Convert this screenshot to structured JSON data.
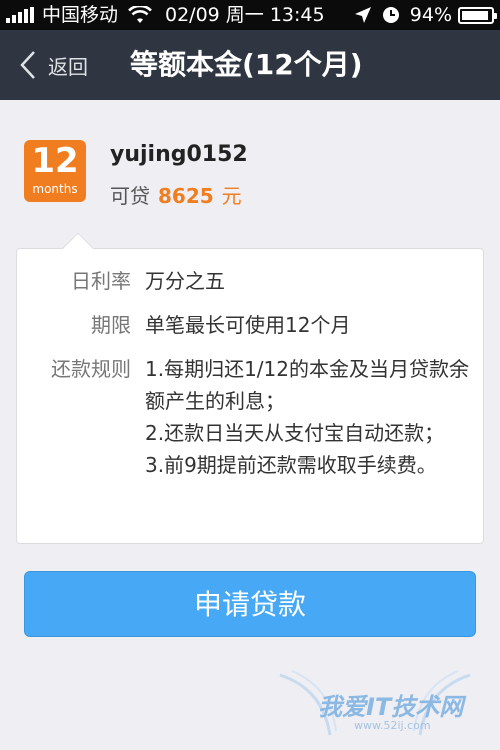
{
  "status_bar": {
    "carrier": "中国移动",
    "datetime": "02/09 周一 13:45",
    "battery": "94%",
    "battery_level": 0.94
  },
  "nav": {
    "back_label": "返回",
    "title": "等额本金(12个月)"
  },
  "badge": {
    "number": "12",
    "unit": "months",
    "color": "#f07d1f"
  },
  "profile": {
    "username": "yujing0152",
    "credit_label": "可贷",
    "credit_amount": "8625",
    "credit_unit": "元"
  },
  "details": {
    "rate_label": "日利率",
    "rate_value": "万分之五",
    "term_label": "期限",
    "term_value": "单笔最长可使用12个月",
    "rules_label": "还款规则",
    "rules": [
      "1.每期归还1/12的本金及当月贷款余额产生的利息；",
      "2.还款日当天从支付宝自动还款；",
      "3.前9期提前还款需收取手续费。"
    ]
  },
  "apply_button": {
    "label": "申请贷款",
    "color": "#47a8f5"
  },
  "watermark": {
    "text": "我爱IT技术网",
    "url": "www.52ij.com"
  }
}
